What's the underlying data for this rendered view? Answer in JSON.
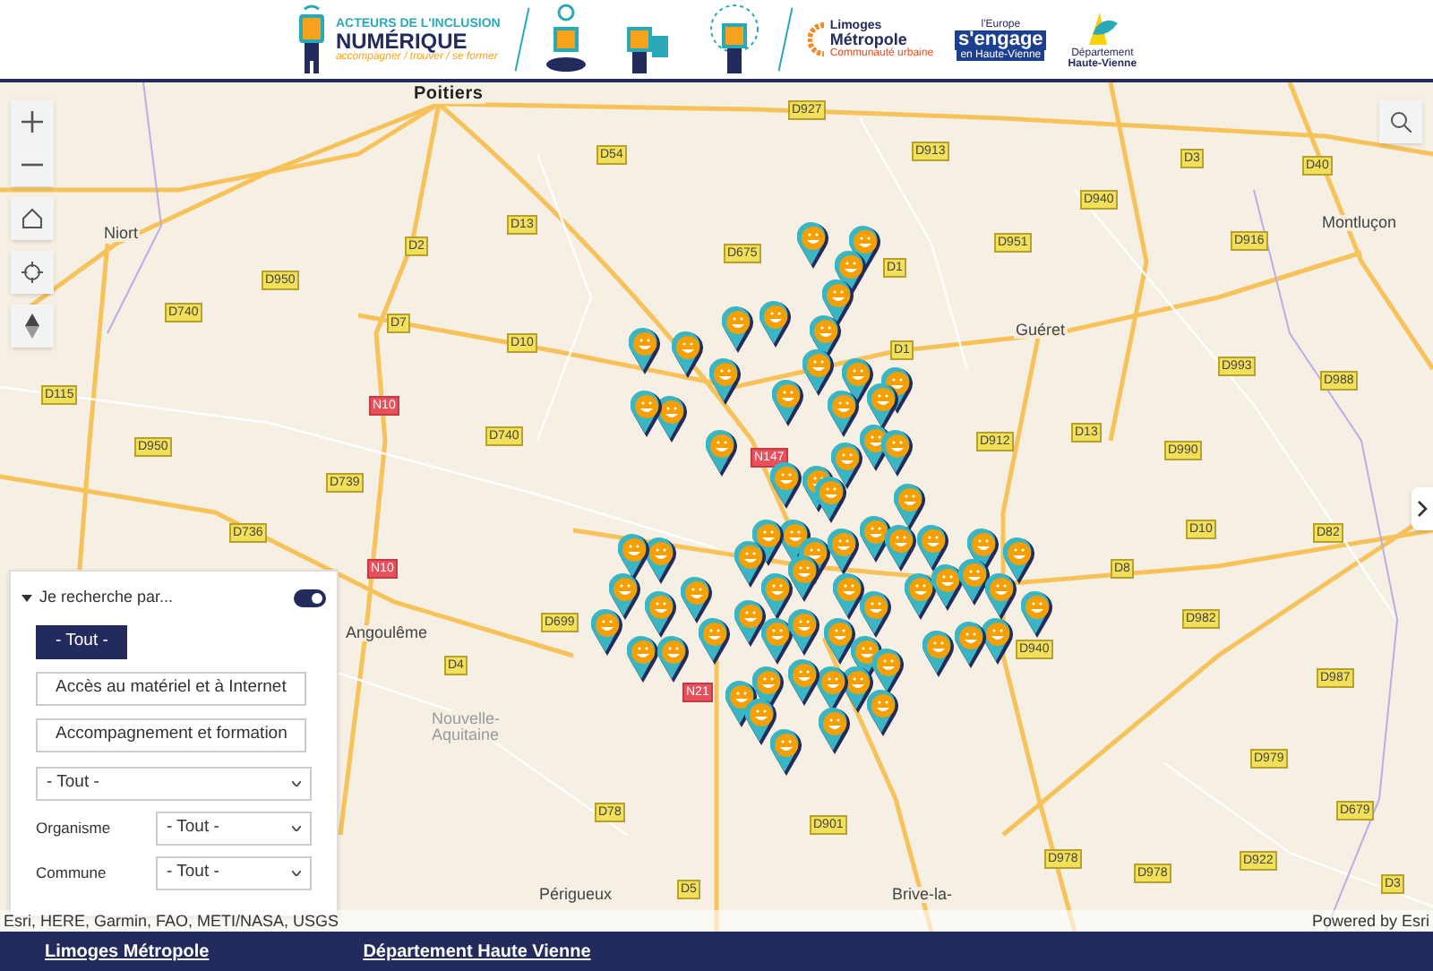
{
  "header": {
    "logos": [
      {
        "kind": "acteurs",
        "lines": [
          "ACTEURS DE L'INCLUSION",
          "NUMÉRIQUE",
          "accompagner / trouver / se former"
        ]
      },
      {
        "kind": "limoges",
        "lines": [
          "Limoges",
          "Métropole",
          "Communauté urbaine"
        ]
      },
      {
        "kind": "europe",
        "lines": [
          "l'Europe",
          "s'engage",
          "en Haute-Vienne"
        ]
      },
      {
        "kind": "departement",
        "lines": [
          "Département",
          "Haute-Vienne"
        ]
      }
    ]
  },
  "map": {
    "places": [
      {
        "text": "Poitiers",
        "kind": "city"
      },
      {
        "text": "Niort",
        "kind": "town"
      },
      {
        "text": "Guéret",
        "kind": "town"
      },
      {
        "text": "Montluçon",
        "kind": "town"
      },
      {
        "text": "Angoulême",
        "kind": "town"
      },
      {
        "text": "Nouvelle-",
        "kind": "region"
      },
      {
        "text": "Aquitaine",
        "kind": "region"
      },
      {
        "text": "Périgueux",
        "kind": "town"
      },
      {
        "text": "Brive-la-",
        "kind": "town"
      }
    ],
    "road_shields": [
      {
        "text": "D927",
        "kind": "d"
      },
      {
        "text": "D54",
        "kind": "d"
      },
      {
        "text": "D913",
        "kind": "d"
      },
      {
        "text": "D13",
        "kind": "d"
      },
      {
        "text": "D3",
        "kind": "d"
      },
      {
        "text": "D40",
        "kind": "d"
      },
      {
        "text": "D940",
        "kind": "d"
      },
      {
        "text": "D2",
        "kind": "d"
      },
      {
        "text": "D675",
        "kind": "d"
      },
      {
        "text": "D951",
        "kind": "d"
      },
      {
        "text": "D1",
        "kind": "d"
      },
      {
        "text": "D916",
        "kind": "d"
      },
      {
        "text": "D950",
        "kind": "d"
      },
      {
        "text": "D740",
        "kind": "d"
      },
      {
        "text": "D7",
        "kind": "d"
      },
      {
        "text": "D10",
        "kind": "d"
      },
      {
        "text": "D1",
        "kind": "d"
      },
      {
        "text": "D115",
        "kind": "d"
      },
      {
        "text": "D993",
        "kind": "d"
      },
      {
        "text": "D988",
        "kind": "d"
      },
      {
        "text": "N10",
        "kind": "n"
      },
      {
        "text": "D740",
        "kind": "d"
      },
      {
        "text": "D912",
        "kind": "d"
      },
      {
        "text": "D13",
        "kind": "d"
      },
      {
        "text": "D990",
        "kind": "d"
      },
      {
        "text": "D950",
        "kind": "d"
      },
      {
        "text": "D739",
        "kind": "d"
      },
      {
        "text": "N147",
        "kind": "n"
      },
      {
        "text": "D736",
        "kind": "d"
      },
      {
        "text": "D10",
        "kind": "d"
      },
      {
        "text": "D82",
        "kind": "d"
      },
      {
        "text": "N10",
        "kind": "n"
      },
      {
        "text": "D699",
        "kind": "d"
      },
      {
        "text": "D4",
        "kind": "d"
      },
      {
        "text": "N21",
        "kind": "n"
      },
      {
        "text": "D8",
        "kind": "d"
      },
      {
        "text": "D982",
        "kind": "d"
      },
      {
        "text": "D940",
        "kind": "d"
      },
      {
        "text": "D987",
        "kind": "d"
      },
      {
        "text": "D78",
        "kind": "d"
      },
      {
        "text": "D901",
        "kind": "d"
      },
      {
        "text": "D979",
        "kind": "d"
      },
      {
        "text": "D679",
        "kind": "d"
      },
      {
        "text": "D978",
        "kind": "d"
      },
      {
        "text": "D978",
        "kind": "d"
      },
      {
        "text": "D922",
        "kind": "d"
      },
      {
        "text": "D5",
        "kind": "d"
      },
      {
        "text": "D3",
        "kind": "d"
      }
    ]
  },
  "filter_panel": {
    "title": "Je recherche par...",
    "expanded": true,
    "toggle_on": true,
    "category_buttons": [
      {
        "label": "- Tout -",
        "selected": true
      },
      {
        "label": "Accès au matériel et à Internet",
        "selected": false
      },
      {
        "label": "Accompagnement et formation",
        "selected": false
      }
    ],
    "type_select": {
      "value": "- Tout -"
    },
    "fields": [
      {
        "label": "Organisme",
        "value": "- Tout -"
      },
      {
        "label": "Commune",
        "value": "- Tout -"
      }
    ]
  },
  "attribution": "Esri, HERE, Garmin, FAO, METI/NASA, USGS",
  "powered_by": "Powered by Esri",
  "footer": {
    "links": [
      "Limoges Métropole",
      "Département Haute Vienne"
    ]
  }
}
